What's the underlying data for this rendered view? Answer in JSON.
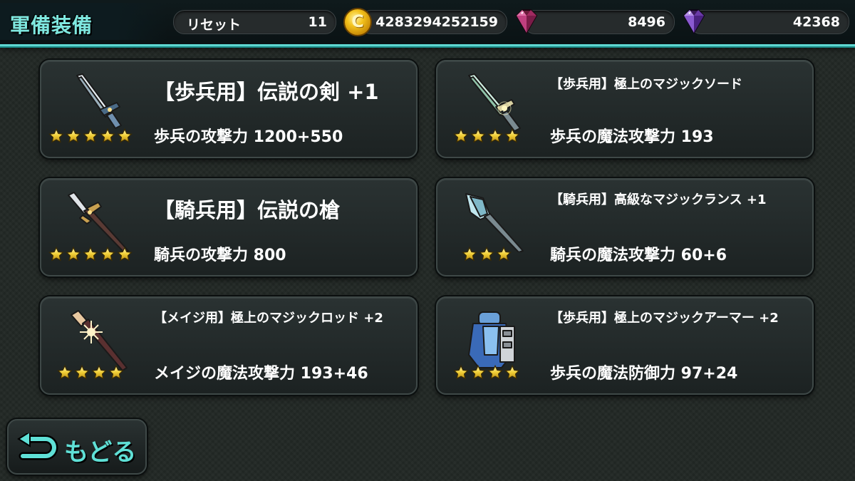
{
  "header": {
    "title": "軍備装備",
    "reset_label": "リセット",
    "reset_count": "11",
    "coin_symbol": "C",
    "gold": "4283294252159",
    "gem_red": "8496",
    "gem_purple": "42368"
  },
  "items": [
    {
      "name": "【歩兵用】伝説の剣 +1",
      "stat": "歩兵の攻撃力 1200+550",
      "stars": 5,
      "icon": "sword-icon"
    },
    {
      "name": "【歩兵用】極上のマジックソード",
      "stat": "歩兵の魔法攻撃力 193",
      "stars": 4,
      "icon": "magic-sword-icon"
    },
    {
      "name": "【騎兵用】伝説の槍",
      "stat": "騎兵の攻撃力 800",
      "stars": 5,
      "icon": "spear-icon"
    },
    {
      "name": "【騎兵用】高級なマジックランス +1",
      "stat": "騎兵の魔法攻撃力 60+6",
      "stars": 3,
      "icon": "magic-lance-icon"
    },
    {
      "name": "【メイジ用】極上のマジックロッド +2",
      "stat": "メイジの魔法攻撃力 193+46",
      "stars": 4,
      "icon": "magic-rod-icon"
    },
    {
      "name": "【歩兵用】極上のマジックアーマー +2",
      "stat": "歩兵の魔法防御力 97+24",
      "stars": 4,
      "icon": "armor-icon"
    }
  ],
  "back_label": "もどる",
  "colors": {
    "accent": "#5fd6d0",
    "star": "#f2d74a"
  }
}
